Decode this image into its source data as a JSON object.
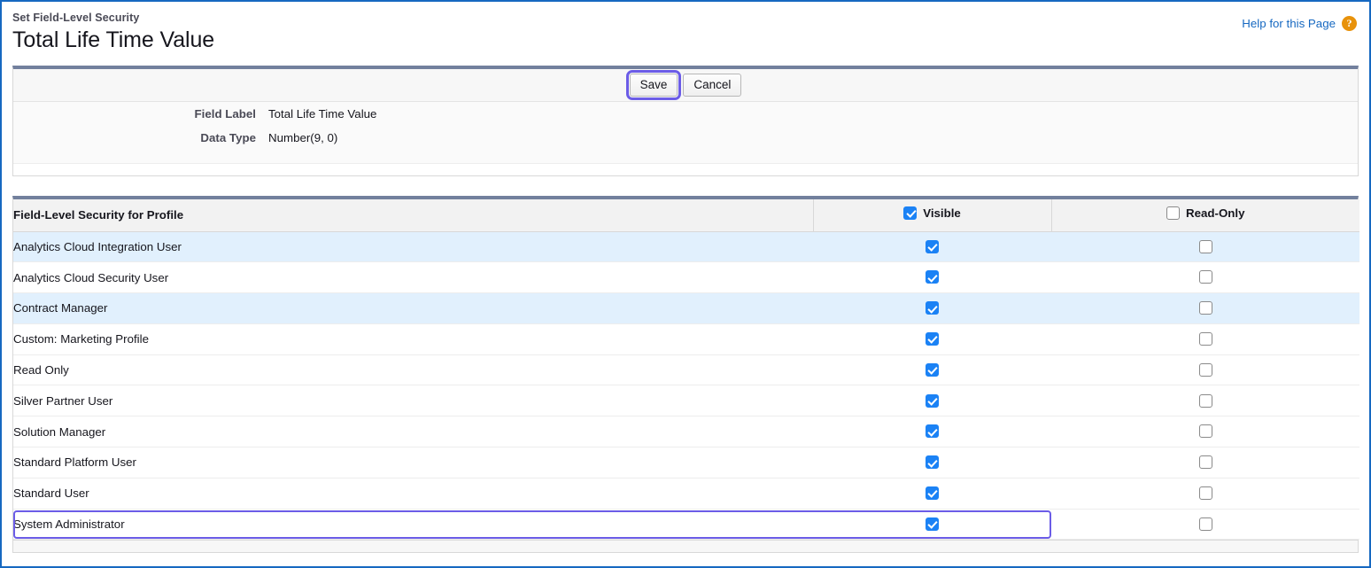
{
  "page": {
    "eyebrow": "Set Field-Level Security",
    "title": "Total Life Time Value",
    "border_color": "#1668c1"
  },
  "help": {
    "label": "Help for this Page",
    "icon": "help-question-icon",
    "icon_glyph": "?",
    "icon_color": "#e8920b",
    "link_color": "#1668c1"
  },
  "toolbar": {
    "save_label": "Save",
    "cancel_label": "Cancel",
    "focused_button": "Save",
    "focus_ring_color": "#6b5ce7"
  },
  "details": [
    {
      "label": "Field Label",
      "value": "Total Life Time Value"
    },
    {
      "label": "Data Type",
      "value": "Number(9, 0)"
    }
  ],
  "table": {
    "columns": {
      "profile": "Field-Level Security for Profile",
      "visible": "Visible",
      "readonly": "Read-Only"
    },
    "header_checkboxes": {
      "visible": true,
      "readonly": false
    },
    "checkbox_checked_color": "#1b82f5",
    "alt_row_color": "#e1f0fd",
    "rows": [
      {
        "profile": "Analytics Cloud Integration User",
        "visible": true,
        "readonly": false,
        "shaded": true,
        "focused": false
      },
      {
        "profile": "Analytics Cloud Security User",
        "visible": true,
        "readonly": false,
        "shaded": false,
        "focused": false
      },
      {
        "profile": "Contract Manager",
        "visible": true,
        "readonly": false,
        "shaded": true,
        "focused": false
      },
      {
        "profile": "Custom: Marketing Profile",
        "visible": true,
        "readonly": false,
        "shaded": false,
        "focused": false
      },
      {
        "profile": "Read Only",
        "visible": true,
        "readonly": false,
        "shaded": false,
        "focused": false
      },
      {
        "profile": "Silver Partner User",
        "visible": true,
        "readonly": false,
        "shaded": false,
        "focused": false
      },
      {
        "profile": "Solution Manager",
        "visible": true,
        "readonly": false,
        "shaded": false,
        "focused": false
      },
      {
        "profile": "Standard Platform User",
        "visible": true,
        "readonly": false,
        "shaded": false,
        "focused": false
      },
      {
        "profile": "Standard User",
        "visible": true,
        "readonly": false,
        "shaded": false,
        "focused": false
      },
      {
        "profile": "System Administrator",
        "visible": true,
        "readonly": false,
        "shaded": false,
        "focused": true
      }
    ]
  }
}
